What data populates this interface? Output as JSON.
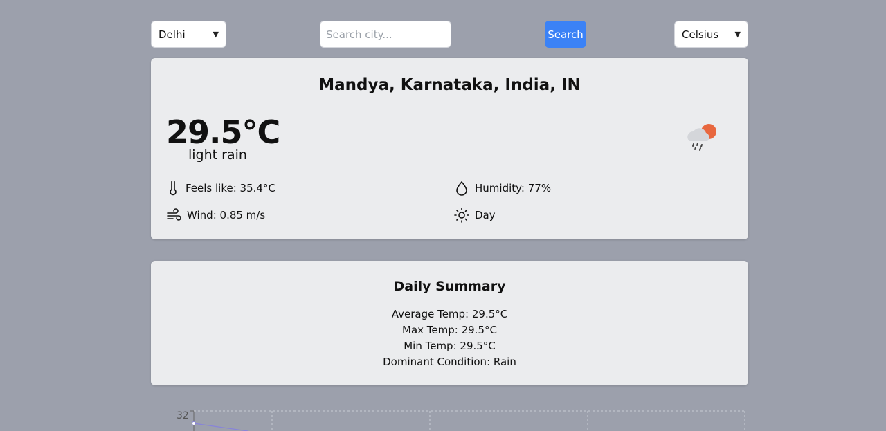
{
  "controls": {
    "city_select": "Delhi",
    "search_placeholder": "Search city...",
    "search_label": "Search",
    "unit_select": "Celsius"
  },
  "weather": {
    "location": "Mandya, Karnataka, India, IN",
    "temperature": "29.5°C",
    "description": "light rain",
    "feels_like": "Feels like: 35.4°C",
    "humidity": "Humidity: 77%",
    "wind": "Wind: 0.85 m/s",
    "day_night": "Day",
    "icon": "rain-with-sun-icon"
  },
  "summary": {
    "title": "Daily Summary",
    "average": "Average Temp: 29.5°C",
    "max": "Max Temp: 29.5°C",
    "min": "Min Temp: 29.5°C",
    "dominant": "Dominant Condition: Rain"
  },
  "chart_data": {
    "type": "line",
    "y_tick_visible": "32",
    "title": "",
    "xlabel": "",
    "ylabel": ""
  },
  "colors": {
    "accent": "#3b82f6",
    "background": "#9ca0ac",
    "card": "#ebecee",
    "line": "#8884d8"
  }
}
